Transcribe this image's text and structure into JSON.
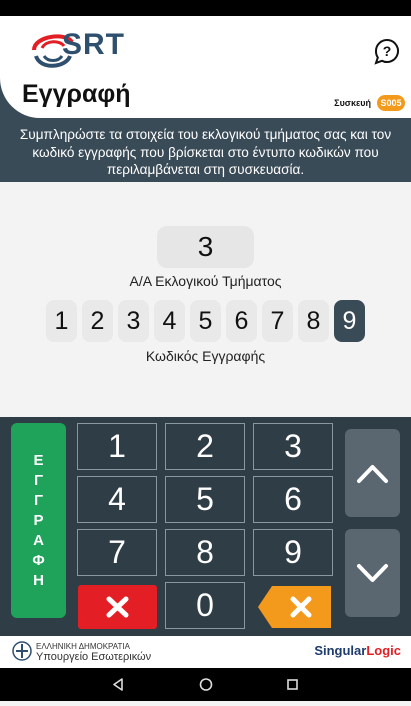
{
  "header": {
    "logo_text": "SRT",
    "title": "Εγγραφή",
    "device_label": "Συσκευή",
    "device_id": "S005"
  },
  "instructions": "Συμπληρώστε τα στοιχεία του εκλογικού τμήματος σας και τον κωδικό εγγραφής που βρίσκεται στο έντυπο κωδικών που περιλαμβάνεται στη συσκευασία.",
  "form": {
    "section_value": "3",
    "section_label": "Α/Α Εκλογικού Τμήματος",
    "code_digits": [
      "1",
      "2",
      "3",
      "4",
      "5",
      "6",
      "7",
      "8",
      "9"
    ],
    "active_digit_index": 8,
    "code_label": "Κωδικός Εγγραφής"
  },
  "keypad": {
    "register_label_letters": [
      "Ε",
      "Γ",
      "Γ",
      "Ρ",
      "Α",
      "Φ",
      "Η"
    ],
    "keys": [
      "1",
      "2",
      "3",
      "4",
      "5",
      "6",
      "7",
      "8",
      "9",
      "0"
    ]
  },
  "footer": {
    "gov_line1": "ΕΛΛΗΝΙΚΗ ΔΗΜΟΚΡΑΤΙΑ",
    "gov_line2": "Υπουργείο Εσωτερικών",
    "partner_logo_a": "Singular",
    "partner_logo_b": "Logic"
  },
  "colors": {
    "header_dark": "#3a4b58",
    "accent_green": "#1fa25a",
    "clear_red": "#e31e24",
    "backspace_orange": "#f39a1c"
  },
  "icons": [
    "help-icon",
    "close-icon",
    "backspace-icon",
    "chevron-up-icon",
    "chevron-down-icon",
    "back-icon",
    "home-icon",
    "recents-icon"
  ]
}
